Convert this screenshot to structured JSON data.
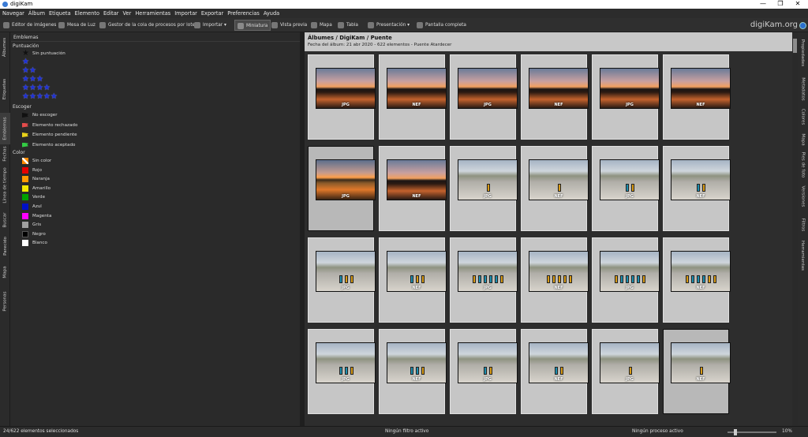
{
  "window": {
    "title": "digiKam",
    "controls": [
      "—",
      "❐",
      "✕"
    ]
  },
  "menu": [
    "Navegar",
    "Álbum",
    "Etiqueta",
    "Elemento",
    "Editar",
    "Ver",
    "Herramientas",
    "Importar",
    "Exportar",
    "Preferencias",
    "Ayuda"
  ],
  "toolbar": {
    "editor": "Editor de imágenes",
    "mesa": "Mesa de Luz",
    "gestor": "Gestor de la cola de procesos por lotes",
    "importar": "Importar",
    "miniatura": "Miniatura",
    "vista_previa": "Vista previa",
    "mapa": "Mapa",
    "tabla": "Tabla",
    "presentacion": "Presentación",
    "pantalla": "Pantalla completa"
  },
  "logo": "digiKam.org",
  "left_tabs": [
    "Álbumes",
    "Etiquetas",
    "Emblemas",
    "Fechas",
    "Línea de tiempo",
    "Buscar",
    "Parecido",
    "Mapa",
    "Personas"
  ],
  "left_panel": {
    "header": "Emblemas",
    "rating_title": "Puntuación",
    "no_rating": "Sin puntuación",
    "pick_title": "Escoger",
    "picks": [
      {
        "label": "No escoger",
        "color": "#111111"
      },
      {
        "label": "Elemento rechazado",
        "color": "#e34b4b"
      },
      {
        "label": "Elemento pendiente",
        "color": "#e8d21a"
      },
      {
        "label": "Elemento aceptado",
        "color": "#33cc44"
      }
    ],
    "color_title": "Color",
    "colors": [
      {
        "label": "Sin color",
        "color": "#ff8a00"
      },
      {
        "label": "Rojo",
        "color": "#e50000"
      },
      {
        "label": "Naranja",
        "color": "#ff9a00"
      },
      {
        "label": "Amarillo",
        "color": "#f2e800"
      },
      {
        "label": "Verde",
        "color": "#00a000"
      },
      {
        "label": "Azul",
        "color": "#0010c8"
      },
      {
        "label": "Magenta",
        "color": "#ff00ff"
      },
      {
        "label": "Gris",
        "color": "#a0a0a0"
      },
      {
        "label": "Negro",
        "color": "#000000"
      },
      {
        "label": "Blanco",
        "color": "#ffffff"
      }
    ]
  },
  "album": {
    "path": "Álbumes / DigiKam / Puente",
    "info": "Fecha del álbum: 21 abr 2020 - 622 elementos - Puente Atardecer"
  },
  "thumbs": [
    {
      "type": "sunset",
      "badge": "JPG",
      "sel": true
    },
    {
      "type": "sunset",
      "badge": "NEF",
      "sel": true
    },
    {
      "type": "sunset",
      "badge": "JPG",
      "sel": true
    },
    {
      "type": "sunset",
      "badge": "NEF",
      "sel": true
    },
    {
      "type": "sunset",
      "badge": "JPG",
      "sel": true
    },
    {
      "type": "sunset",
      "badge": "NEF",
      "sel": true
    },
    {
      "type": "sunset2",
      "badge": "JPG",
      "sel": false
    },
    {
      "type": "sunset",
      "badge": "NEF",
      "sel": true
    },
    {
      "type": "flags",
      "badge": "JPG",
      "sel": true,
      "bottles": [
        "y"
      ]
    },
    {
      "type": "flags",
      "badge": "NEF",
      "sel": true,
      "bottles": [
        "y"
      ]
    },
    {
      "type": "flags",
      "badge": "JPG",
      "sel": true,
      "bottles": [
        "b",
        "y"
      ]
    },
    {
      "type": "flags",
      "badge": "NEF",
      "sel": true,
      "bottles": [
        "b",
        "y"
      ]
    },
    {
      "type": "flags",
      "badge": "JPG",
      "sel": true,
      "bottles": [
        "b",
        "y",
        "y"
      ]
    },
    {
      "type": "flags",
      "badge": "NEF",
      "sel": true,
      "bottles": [
        "b",
        "y",
        "y"
      ]
    },
    {
      "type": "flags",
      "badge": "JPG",
      "sel": true,
      "bottles": [
        "y",
        "b",
        "b",
        "b",
        "b",
        "y"
      ]
    },
    {
      "type": "flags",
      "badge": "NEF",
      "sel": true,
      "bottles": [
        "y",
        "y",
        "y",
        "y",
        "y"
      ]
    },
    {
      "type": "flags",
      "badge": "JPG",
      "sel": true,
      "bottles": [
        "y",
        "b",
        "b",
        "b",
        "b",
        "y"
      ]
    },
    {
      "type": "flags",
      "badge": "NEF",
      "sel": true,
      "bottles": [
        "y",
        "b",
        "b",
        "b",
        "y",
        "y"
      ]
    },
    {
      "type": "flags",
      "badge": "JPG",
      "sel": true,
      "bottles": [
        "b",
        "b",
        "y"
      ]
    },
    {
      "type": "flags",
      "badge": "NEF",
      "sel": true,
      "bottles": [
        "b",
        "b",
        "y"
      ]
    },
    {
      "type": "flags",
      "badge": "JPG",
      "sel": true,
      "bottles": [
        "b",
        "y"
      ]
    },
    {
      "type": "flags",
      "badge": "NEF",
      "sel": true,
      "bottles": [
        "b",
        "y"
      ]
    },
    {
      "type": "flags",
      "badge": "JPG",
      "sel": true,
      "bottles": [
        "y"
      ]
    },
    {
      "type": "flags",
      "badge": "NEF",
      "sel": false,
      "bottles": [
        "y"
      ]
    }
  ],
  "right_tabs": [
    "Propiedades",
    "Metadatos",
    "Colores",
    "Mapa",
    "Pies de foto",
    "Versiones",
    "Filtros",
    "Herramientas"
  ],
  "status": {
    "selected": "24/622 elementos seleccionados",
    "filter": "Ningún filtro activo",
    "process": "Ningún proceso activo",
    "zoom": "10%"
  }
}
